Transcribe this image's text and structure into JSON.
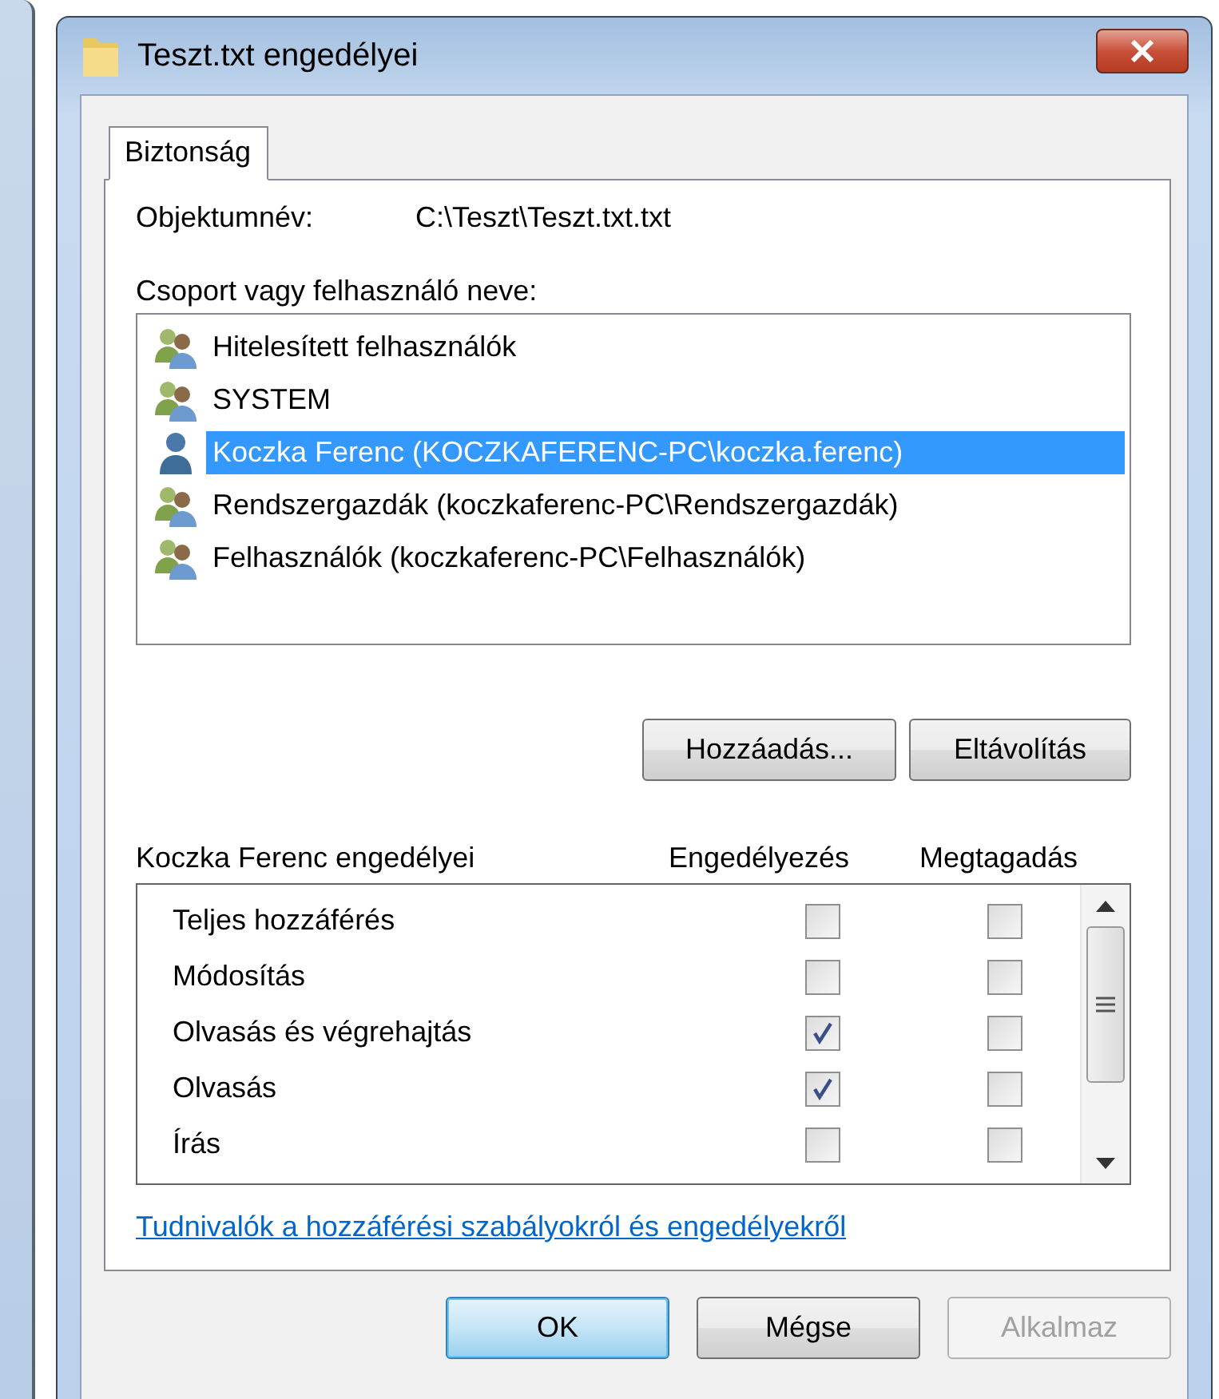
{
  "window": {
    "title": "Teszt.txt engedélyei"
  },
  "tabs": [
    {
      "label": "Biztonság",
      "selected": true
    }
  ],
  "object_name": {
    "label": "Objektumnév:",
    "value": "C:\\Teszt\\Teszt.txt.txt"
  },
  "principals_label": "Csoport vagy felhasználó neve:",
  "principals": [
    {
      "name": "Hitelesített felhasználók",
      "kind": "group",
      "selected": false
    },
    {
      "name": "SYSTEM",
      "kind": "group",
      "selected": false
    },
    {
      "name": "Koczka Ferenc (KOCZKAFERENC-PC\\koczka.ferenc)",
      "kind": "user",
      "selected": true
    },
    {
      "name": "Rendszergazdák (koczkaferenc-PC\\Rendszergazdák)",
      "kind": "group",
      "selected": false
    },
    {
      "name": "Felhasználók (koczkaferenc-PC\\Felhasználók)",
      "kind": "group",
      "selected": false
    }
  ],
  "principal_buttons": [
    "Hozzáadás...",
    "Eltávolítás"
  ],
  "permissions_header": {
    "title": "Koczka Ferenc engedélyei",
    "allow": "Engedélyezés",
    "deny": "Megtagadás"
  },
  "permissions": [
    {
      "name": "Teljes hozzáférés",
      "allow": false,
      "deny": false
    },
    {
      "name": "Módosítás",
      "allow": false,
      "deny": false
    },
    {
      "name": "Olvasás és végrehajtás",
      "allow": true,
      "deny": false
    },
    {
      "name": "Olvasás",
      "allow": true,
      "deny": false
    },
    {
      "name": "Írás",
      "allow": false,
      "deny": false
    }
  ],
  "link": "Tudnivalók a hozzáférési szabályokról és engedélyekről",
  "dialog_buttons": [
    {
      "label": "OK",
      "default": true,
      "disabled": false
    },
    {
      "label": "Mégse",
      "default": false,
      "disabled": false
    },
    {
      "label": "Alkalmaz",
      "default": false,
      "disabled": true
    }
  ]
}
